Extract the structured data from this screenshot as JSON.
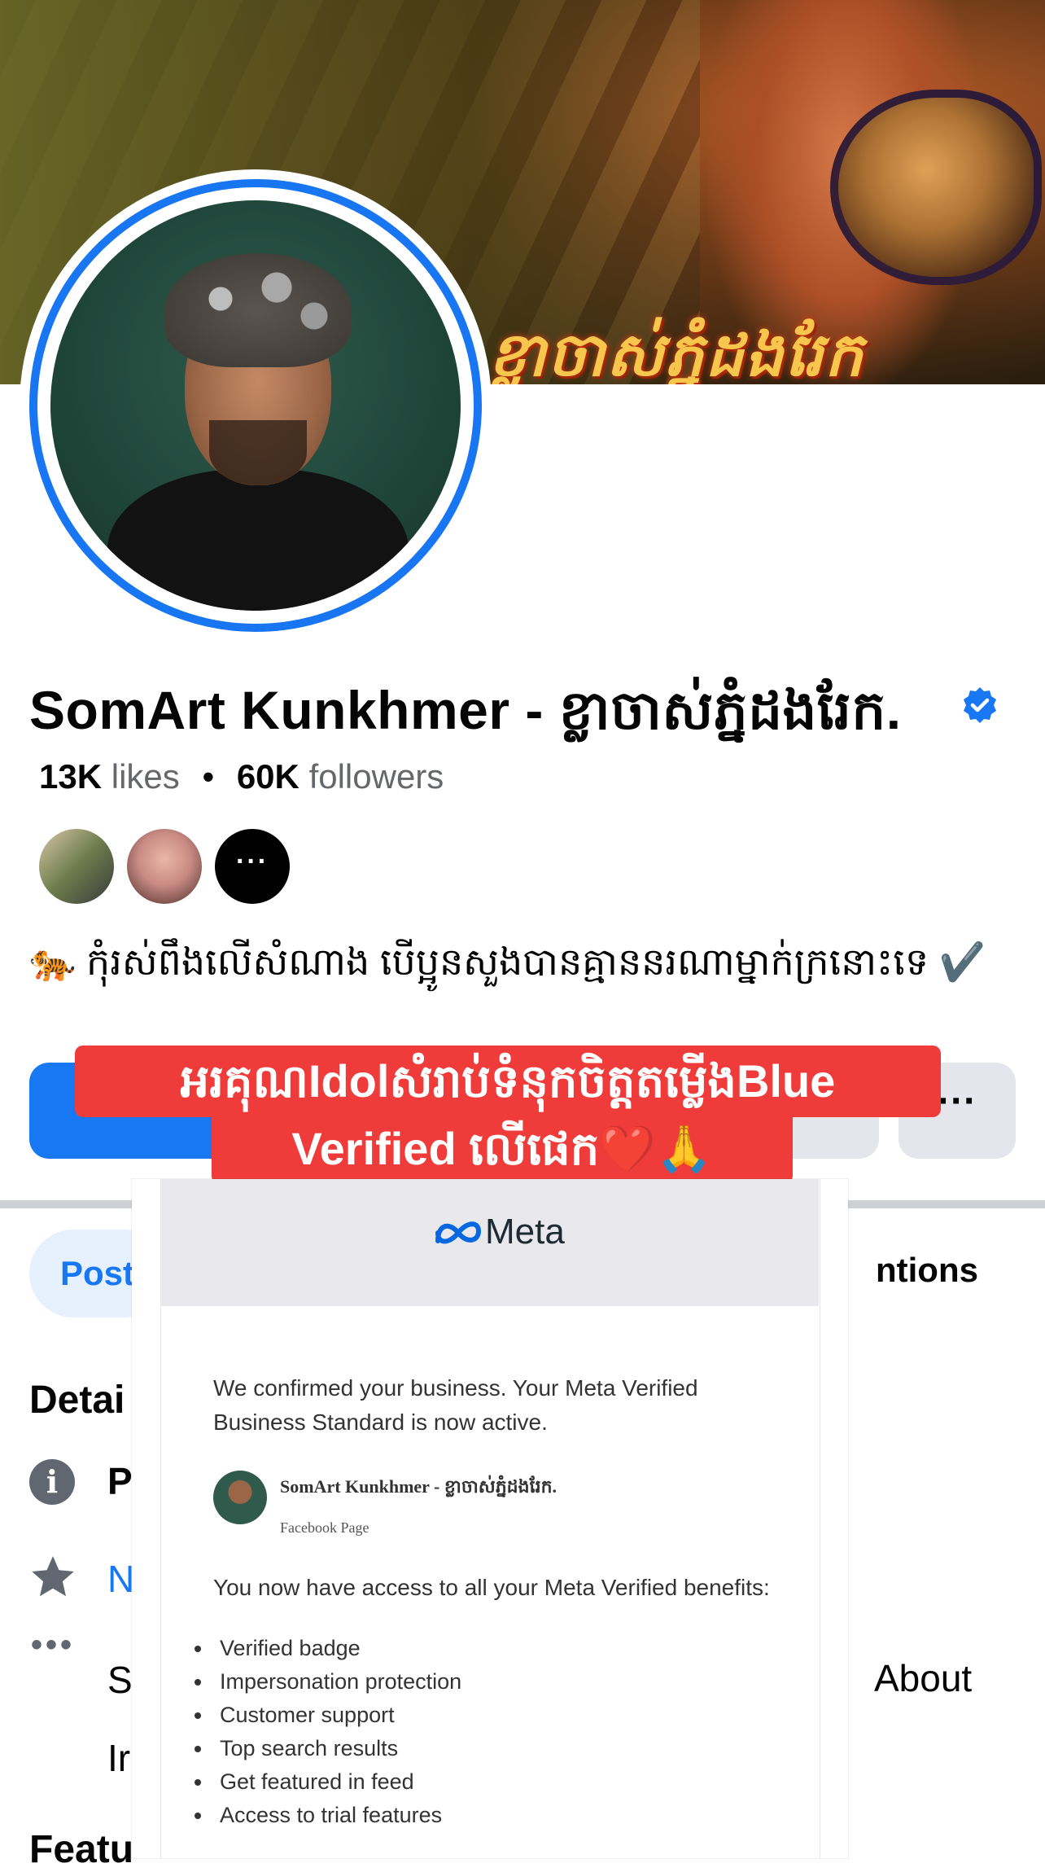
{
  "profile": {
    "cover_text": "ខ្លាចាស់ភ្នំដងរែក",
    "name": "SomArt Kunkhmer - ខ្លាចាស់ភ្នំដងរែក.",
    "likes_count": "13K",
    "likes_label": "likes",
    "followers_count": "60K",
    "followers_label": "followers",
    "friends_more": "···",
    "bio": "🐅 កុំរស់ពឹងលើសំណាង បើប្អូនសួងបានគ្មាននរណាម្នាក់ក្រនោះទេ ✔️",
    "more_button": "···"
  },
  "caption": {
    "line1": "អរគុណIdolសំរាប់ទំនុកចិត្តតម្លើងBlue",
    "line2": "Verified លើផេក❤️🙏"
  },
  "tabs": {
    "posts": "Post",
    "mentions": "ntions"
  },
  "details": {
    "title": "Detai",
    "info_item": "P",
    "star_item": "N",
    "more_item": "S",
    "intro_item": "Ir",
    "about": "About",
    "featured": "Featu"
  },
  "meta_email": {
    "brand": "Meta",
    "confirm_text": "We confirmed your business. Your Meta Verified Business Standard is now active.",
    "page_name": "SomArt Kunkhmer - ខ្លាចាស់ភ្នំដងរែក.",
    "page_type": "Facebook Page",
    "access_text": "You now have access to all your Meta Verified benefits:",
    "benefits": [
      "Verified badge",
      "Impersonation protection",
      "Customer support",
      "Top search results",
      "Get featured in feed",
      "Access to trial features"
    ]
  },
  "colors": {
    "facebook_blue": "#1877f2",
    "caption_red": "#ef3b3a",
    "secondary_gray": "#e4e6eb"
  },
  "icons": [
    "verified-icon",
    "info-icon",
    "star-icon",
    "more-dots-icon",
    "meta-logo-icon"
  ]
}
